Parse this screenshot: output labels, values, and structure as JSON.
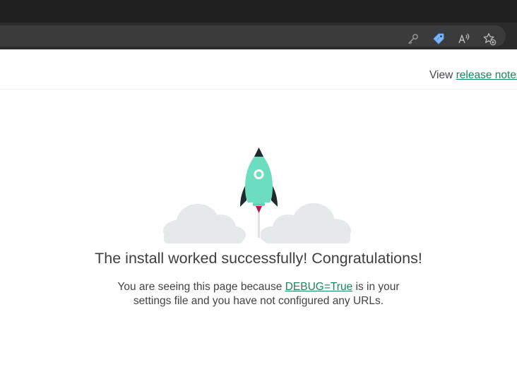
{
  "header": {
    "view_text": "View ",
    "release_link": "release notes"
  },
  "main": {
    "title": "The install worked successfully! Congratulations!",
    "desc_before": "You are seeing this page because ",
    "debug_link": "DEBUG=True",
    "desc_after": " is in your settings file and you have not configured any URLs."
  },
  "colors": {
    "accent": "#19865c",
    "rocket": "#6dddc0",
    "cloud": "#e6e9ea",
    "chrome_dark": "#202020"
  },
  "icons": [
    "key-icon",
    "price-tag-icon",
    "read-aloud-icon",
    "add-favorite-icon"
  ]
}
